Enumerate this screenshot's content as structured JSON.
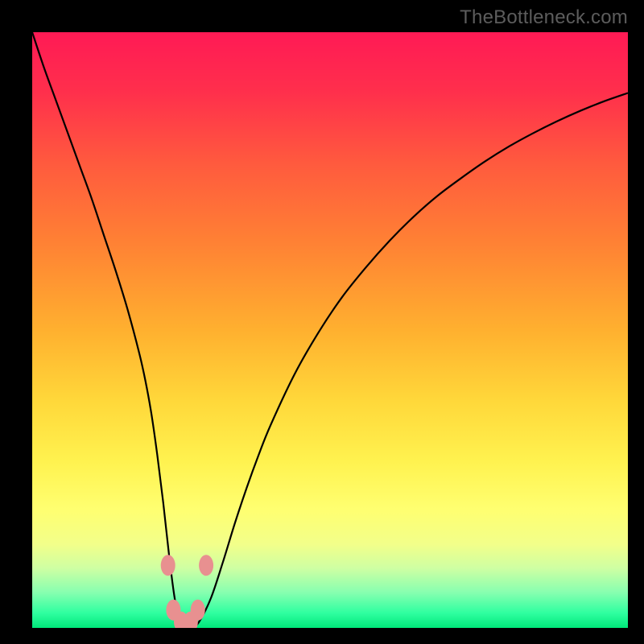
{
  "watermark": "TheBottleneck.com",
  "chart_data": {
    "type": "line",
    "title": "",
    "xlabel": "",
    "ylabel": "",
    "xlim": [
      0,
      100
    ],
    "ylim": [
      0,
      100
    ],
    "x": [
      0,
      2,
      4,
      6,
      8,
      10,
      12,
      14,
      16,
      18,
      19,
      20,
      21,
      22,
      23,
      24,
      25,
      26,
      27,
      28,
      30,
      32,
      34,
      36,
      38,
      40,
      44,
      48,
      52,
      56,
      60,
      64,
      68,
      72,
      76,
      80,
      84,
      88,
      92,
      96,
      100
    ],
    "values": [
      100,
      94,
      88.5,
      83,
      77.5,
      72,
      66,
      60,
      53.5,
      46,
      41.5,
      36,
      29,
      21,
      12,
      4.5,
      1,
      0.3,
      0.3,
      1,
      5,
      11,
      17.5,
      23.5,
      29,
      34,
      42.5,
      49.5,
      55.5,
      60.5,
      65,
      69,
      72.5,
      75.5,
      78.3,
      80.8,
      83,
      85,
      86.8,
      88.4,
      89.8
    ],
    "gradient_stops": [
      {
        "offset": 0.0,
        "color": "#ff1a55"
      },
      {
        "offset": 0.1,
        "color": "#ff2f4c"
      },
      {
        "offset": 0.22,
        "color": "#ff5a3e"
      },
      {
        "offset": 0.35,
        "color": "#ff8034"
      },
      {
        "offset": 0.5,
        "color": "#ffb02f"
      },
      {
        "offset": 0.62,
        "color": "#ffd83a"
      },
      {
        "offset": 0.72,
        "color": "#fff24f"
      },
      {
        "offset": 0.8,
        "color": "#ffff70"
      },
      {
        "offset": 0.86,
        "color": "#f2ff8a"
      },
      {
        "offset": 0.9,
        "color": "#ceffa3"
      },
      {
        "offset": 0.94,
        "color": "#88ffb0"
      },
      {
        "offset": 0.975,
        "color": "#2fffa0"
      },
      {
        "offset": 1.0,
        "color": "#00e87a"
      }
    ],
    "markers": {
      "color": "#e89090",
      "points": [
        {
          "x": 22.8,
          "y": 10.5
        },
        {
          "x": 23.7,
          "y": 3.0
        },
        {
          "x": 25.0,
          "y": 1.0
        },
        {
          "x": 26.6,
          "y": 1.0
        },
        {
          "x": 27.8,
          "y": 3.0
        },
        {
          "x": 29.2,
          "y": 10.5
        }
      ]
    }
  }
}
